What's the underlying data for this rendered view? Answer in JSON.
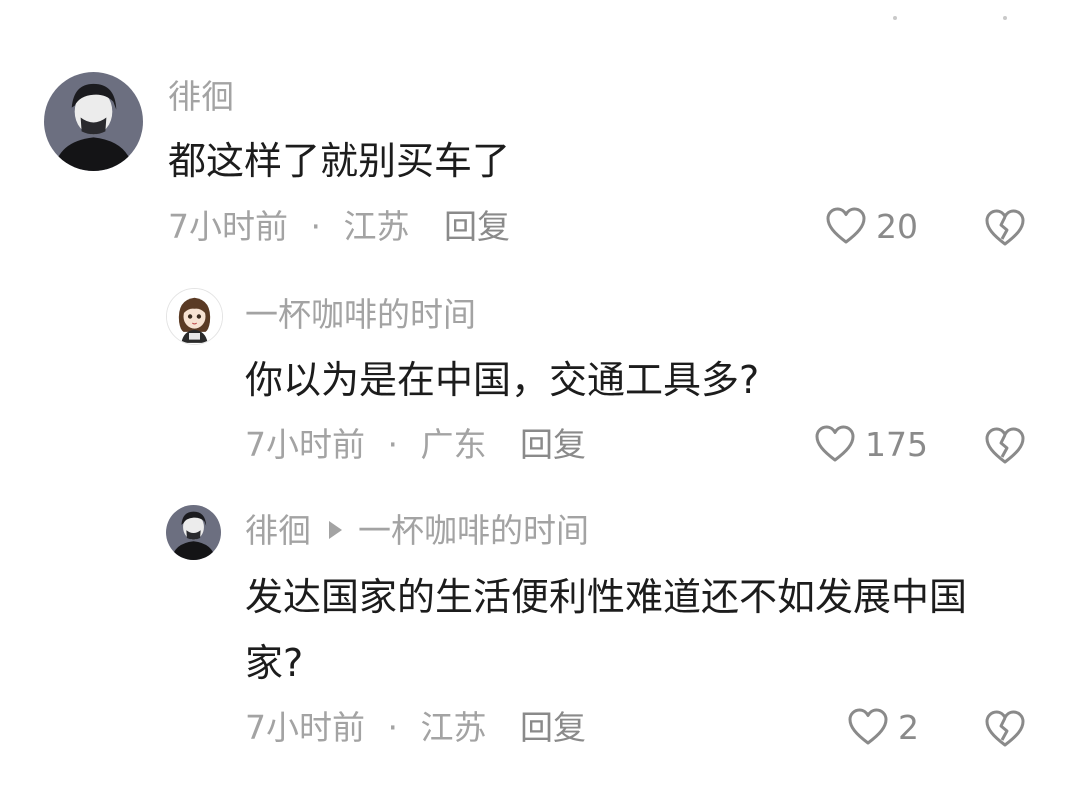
{
  "colors": {
    "muted_text": "#a3a3a3",
    "body_text": "#1c1c1c",
    "icon_stroke": "#8a8a8a"
  },
  "comments": [
    {
      "username": "徘徊",
      "text_lines": [
        "都这样了就别买车了"
      ],
      "time": "7小时前",
      "location": "江苏",
      "reply_label": "回复",
      "likes": "20"
    },
    {
      "username": "一杯咖啡的时间",
      "text_lines": [
        "你以为是在中国，交通工具多?"
      ],
      "time": "7小时前",
      "location": "广东",
      "reply_label": "回复",
      "likes": "175"
    },
    {
      "username": "徘徊",
      "reply_to": "一杯咖啡的时间",
      "text_lines": [
        "发达国家的生活便利性难道还不如发展中国",
        "家?"
      ],
      "time": "7小时前",
      "location": "江苏",
      "reply_label": "回复",
      "likes": "2"
    }
  ],
  "separator": "·",
  "icons": {
    "like": "heart-outline-icon",
    "dislike": "broken-heart-icon",
    "reply_arrow": "triangle-right-icon"
  }
}
